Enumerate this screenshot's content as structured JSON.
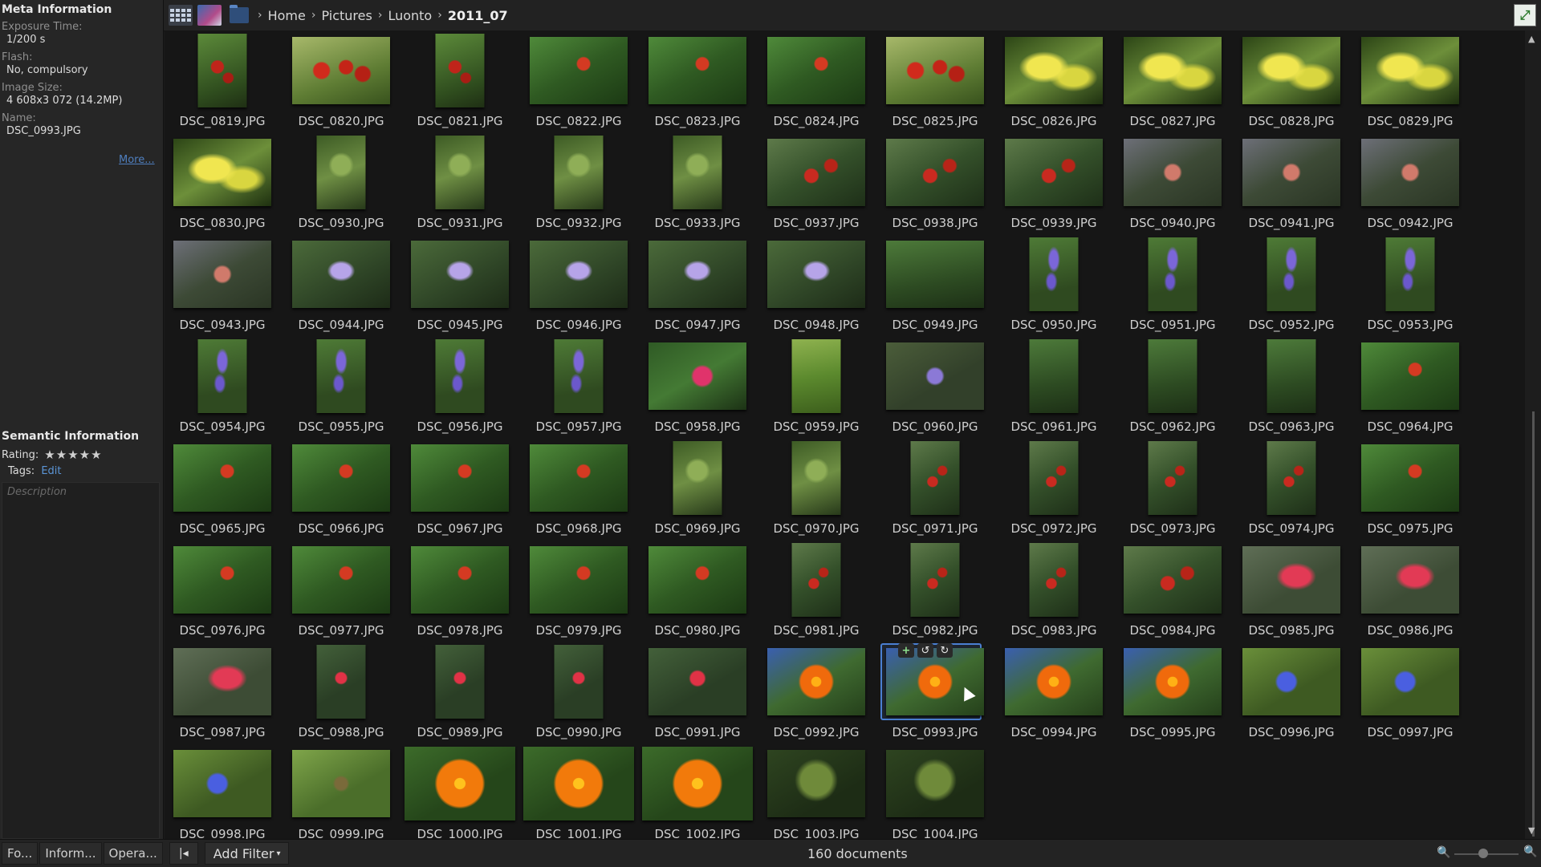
{
  "sidebar": {
    "meta_title": "Meta Information",
    "meta": [
      {
        "label": "Exposure Time:",
        "value": "1/200 s"
      },
      {
        "label": "Flash:",
        "value": "No, compulsory"
      },
      {
        "label": "Image Size:",
        "value": "4 608x3 072 (14.2MP)"
      },
      {
        "label": "Name:",
        "value": "DSC_0993.JPG"
      }
    ],
    "more_link": "More...",
    "semantic_title": "Semantic Information",
    "rating_label": "Rating:",
    "rating": 5,
    "tags_label": "Tags:",
    "tags_edit": "Edit",
    "description_placeholder": "Description"
  },
  "breadcrumb": [
    "Home",
    "Pictures",
    "Luonto",
    "2011_07"
  ],
  "grid": {
    "selected": "DSC_0993.JPG",
    "items": [
      {
        "name": "DSC_0819.JPG",
        "shape": "port",
        "palette": "p-red"
      },
      {
        "name": "DSC_0820.JPG",
        "shape": "land",
        "palette": "p-redbright"
      },
      {
        "name": "DSC_0821.JPG",
        "shape": "port",
        "palette": "p-red"
      },
      {
        "name": "DSC_0822.JPG",
        "shape": "land",
        "palette": "p-leafred"
      },
      {
        "name": "DSC_0823.JPG",
        "shape": "land",
        "palette": "p-leafred"
      },
      {
        "name": "DSC_0824.JPG",
        "shape": "land",
        "palette": "p-leafred"
      },
      {
        "name": "DSC_0825.JPG",
        "shape": "land",
        "palette": "p-redbright"
      },
      {
        "name": "DSC_0826.JPG",
        "shape": "land",
        "palette": "p-yellow"
      },
      {
        "name": "DSC_0827.JPG",
        "shape": "land",
        "palette": "p-yellow"
      },
      {
        "name": "DSC_0828.JPG",
        "shape": "land",
        "palette": "p-yellow"
      },
      {
        "name": "DSC_0829.JPG",
        "shape": "land",
        "palette": "p-yellow"
      },
      {
        "name": "DSC_0830.JPG",
        "shape": "land",
        "palette": "p-yellow"
      },
      {
        "name": "DSC_0930.JPG",
        "shape": "port",
        "palette": "p-green"
      },
      {
        "name": "DSC_0931.JPG",
        "shape": "port",
        "palette": "p-green"
      },
      {
        "name": "DSC_0932.JPG",
        "shape": "port",
        "palette": "p-green"
      },
      {
        "name": "DSC_0933.JPG",
        "shape": "port",
        "palette": "p-green"
      },
      {
        "name": "DSC_0937.JPG",
        "shape": "land",
        "palette": "p-cherry"
      },
      {
        "name": "DSC_0938.JPG",
        "shape": "land",
        "palette": "p-cherry"
      },
      {
        "name": "DSC_0939.JPG",
        "shape": "land",
        "palette": "p-cherry"
      },
      {
        "name": "DSC_0940.JPG",
        "shape": "land",
        "palette": "p-apple"
      },
      {
        "name": "DSC_0941.JPG",
        "shape": "land",
        "palette": "p-apple"
      },
      {
        "name": "DSC_0942.JPG",
        "shape": "land",
        "palette": "p-apple"
      },
      {
        "name": "DSC_0943.JPG",
        "shape": "land",
        "palette": "p-apple"
      },
      {
        "name": "DSC_0944.JPG",
        "shape": "land",
        "palette": "p-bell"
      },
      {
        "name": "DSC_0945.JPG",
        "shape": "land",
        "palette": "p-bell"
      },
      {
        "name": "DSC_0946.JPG",
        "shape": "land",
        "palette": "p-bell"
      },
      {
        "name": "DSC_0947.JPG",
        "shape": "land",
        "palette": "p-bell"
      },
      {
        "name": "DSC_0948.JPG",
        "shape": "land",
        "palette": "p-bell"
      },
      {
        "name": "DSC_0949.JPG",
        "shape": "land",
        "palette": "p-stem"
      },
      {
        "name": "DSC_0950.JPG",
        "shape": "port",
        "palette": "p-bellv"
      },
      {
        "name": "DSC_0951.JPG",
        "shape": "port",
        "palette": "p-bellv"
      },
      {
        "name": "DSC_0952.JPG",
        "shape": "port",
        "palette": "p-bellv"
      },
      {
        "name": "DSC_0953.JPG",
        "shape": "port",
        "palette": "p-bellv"
      },
      {
        "name": "DSC_0954.JPG",
        "shape": "port",
        "palette": "p-bellv"
      },
      {
        "name": "DSC_0955.JPG",
        "shape": "port",
        "palette": "p-bellv"
      },
      {
        "name": "DSC_0956.JPG",
        "shape": "port",
        "palette": "p-bellv"
      },
      {
        "name": "DSC_0957.JPG",
        "shape": "port",
        "palette": "p-bellv"
      },
      {
        "name": "DSC_0958.JPG",
        "shape": "land",
        "palette": "p-pink"
      },
      {
        "name": "DSC_0959.JPG",
        "shape": "port",
        "palette": "p-grass"
      },
      {
        "name": "DSC_0960.JPG",
        "shape": "land",
        "palette": "p-aster"
      },
      {
        "name": "DSC_0961.JPG",
        "shape": "port",
        "palette": "p-stem"
      },
      {
        "name": "DSC_0962.JPG",
        "shape": "port",
        "palette": "p-stem"
      },
      {
        "name": "DSC_0963.JPG",
        "shape": "port",
        "palette": "p-stem"
      },
      {
        "name": "DSC_0964.JPG",
        "shape": "land",
        "palette": "p-leafred"
      },
      {
        "name": "DSC_0965.JPG",
        "shape": "land",
        "palette": "p-leafred"
      },
      {
        "name": "DSC_0966.JPG",
        "shape": "land",
        "palette": "p-leafred"
      },
      {
        "name": "DSC_0967.JPG",
        "shape": "land",
        "palette": "p-leafred"
      },
      {
        "name": "DSC_0968.JPG",
        "shape": "land",
        "palette": "p-leafred"
      },
      {
        "name": "DSC_0969.JPG",
        "shape": "port",
        "palette": "p-green"
      },
      {
        "name": "DSC_0970.JPG",
        "shape": "port",
        "palette": "p-green"
      },
      {
        "name": "DSC_0971.JPG",
        "shape": "port",
        "palette": "p-cherry"
      },
      {
        "name": "DSC_0972.JPG",
        "shape": "port",
        "palette": "p-cherry"
      },
      {
        "name": "DSC_0973.JPG",
        "shape": "port",
        "palette": "p-cherry"
      },
      {
        "name": "DSC_0974.JPG",
        "shape": "port",
        "palette": "p-cherry"
      },
      {
        "name": "DSC_0975.JPG",
        "shape": "land",
        "palette": "p-leafred"
      },
      {
        "name": "DSC_0976.JPG",
        "shape": "land",
        "palette": "p-leafred"
      },
      {
        "name": "DSC_0977.JPG",
        "shape": "land",
        "palette": "p-leafred"
      },
      {
        "name": "DSC_0978.JPG",
        "shape": "land",
        "palette": "p-leafred"
      },
      {
        "name": "DSC_0979.JPG",
        "shape": "land",
        "palette": "p-leafred"
      },
      {
        "name": "DSC_0980.JPG",
        "shape": "land",
        "palette": "p-leafred"
      },
      {
        "name": "DSC_0981.JPG",
        "shape": "port",
        "palette": "p-cherry"
      },
      {
        "name": "DSC_0982.JPG",
        "shape": "port",
        "palette": "p-cherry"
      },
      {
        "name": "DSC_0983.JPG",
        "shape": "port",
        "palette": "p-cherry"
      },
      {
        "name": "DSC_0984.JPG",
        "shape": "land",
        "palette": "p-cherry"
      },
      {
        "name": "DSC_0985.JPG",
        "shape": "land",
        "palette": "p-redcl"
      },
      {
        "name": "DSC_0986.JPG",
        "shape": "land",
        "palette": "p-redcl"
      },
      {
        "name": "DSC_0987.JPG",
        "shape": "land",
        "palette": "p-redcl"
      },
      {
        "name": "DSC_0988.JPG",
        "shape": "port",
        "palette": "p-rasp"
      },
      {
        "name": "DSC_0989.JPG",
        "shape": "port",
        "palette": "p-rasp"
      },
      {
        "name": "DSC_0990.JPG",
        "shape": "port",
        "palette": "p-rasp"
      },
      {
        "name": "DSC_0991.JPG",
        "shape": "land",
        "palette": "p-rasp"
      },
      {
        "name": "DSC_0992.JPG",
        "shape": "land",
        "palette": "p-orange"
      },
      {
        "name": "DSC_0993.JPG",
        "shape": "land",
        "palette": "p-orange"
      },
      {
        "name": "DSC_0994.JPG",
        "shape": "land",
        "palette": "p-orange"
      },
      {
        "name": "DSC_0995.JPG",
        "shape": "land",
        "palette": "p-orange"
      },
      {
        "name": "DSC_0996.JPG",
        "shape": "land",
        "palette": "p-blue"
      },
      {
        "name": "DSC_0997.JPG",
        "shape": "land",
        "palette": "p-blue"
      },
      {
        "name": "DSC_0998.JPG",
        "shape": "land",
        "palette": "p-blue"
      },
      {
        "name": "DSC_0999.JPG",
        "shape": "land",
        "palette": "p-bud"
      },
      {
        "name": "DSC_1000.JPG",
        "shape": "wide",
        "palette": "p-orangebig"
      },
      {
        "name": "DSC_1001.JPG",
        "shape": "wide",
        "palette": "p-orangebig"
      },
      {
        "name": "DSC_1002.JPG",
        "shape": "wide",
        "palette": "p-orangebig"
      },
      {
        "name": "DSC_1003.JPG",
        "shape": "land",
        "palette": "p-dill"
      },
      {
        "name": "DSC_1004.JPG",
        "shape": "land",
        "palette": "p-dill"
      }
    ]
  },
  "bottom": {
    "tabs": [
      "Fo...",
      "Inform...",
      "Opera..."
    ],
    "add_filter": "Add Filter",
    "doc_count": "160 documents"
  },
  "icons": {
    "view_grid": "grid-view-icon",
    "view_photo": "photo-view-icon",
    "folder": "folder-icon",
    "expand": "expand-icon",
    "star": "star-icon",
    "zoom_out": "zoom-out-icon",
    "zoom_in": "zoom-in-icon"
  },
  "colors": {
    "accent": "#4a7fd2",
    "link": "#5b95d6",
    "background": "#1b1b1b"
  }
}
